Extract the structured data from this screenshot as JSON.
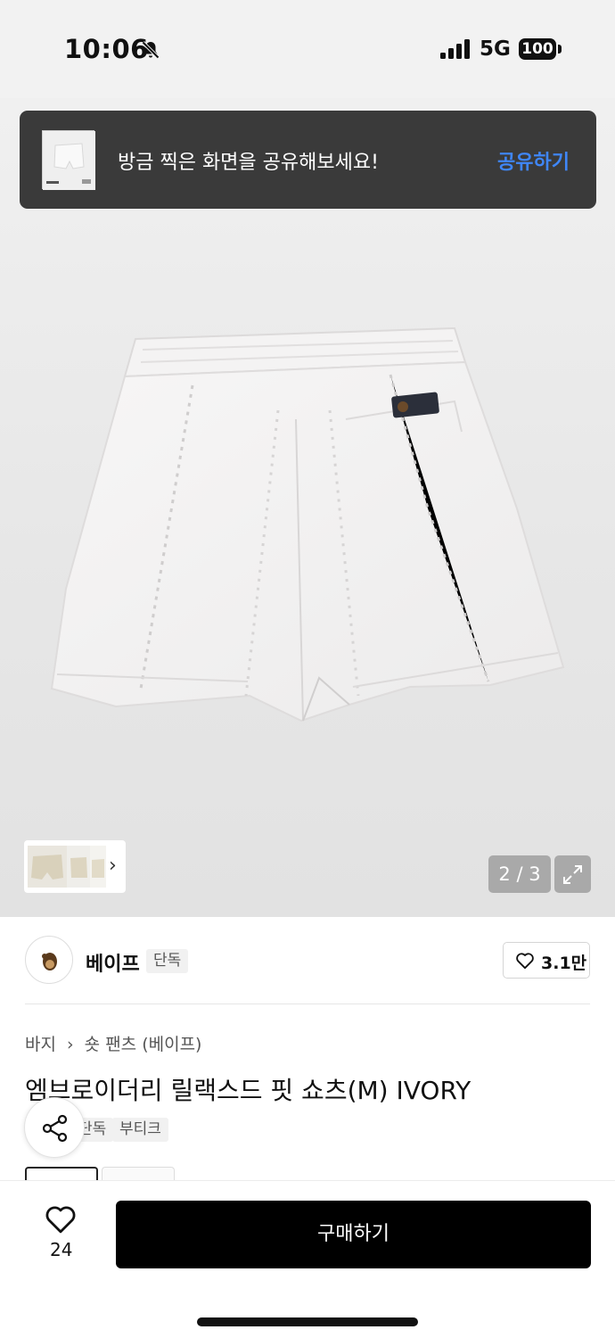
{
  "status_bar": {
    "time": "10:06",
    "network": "5G",
    "battery": "100",
    "icons": [
      "bell-muted-icon",
      "signal-icon",
      "battery-icon"
    ]
  },
  "toast": {
    "message": "방금 찍은 화면을 공유해보세요!",
    "action": "공유하기",
    "action_color": "#3f86f7"
  },
  "gallery": {
    "counter": "2 / 3",
    "chevron": "›"
  },
  "brand": {
    "name": "베이프",
    "badge": "단독",
    "like_count": "3.1만"
  },
  "product": {
    "breadcrumb": [
      "바지",
      "›",
      "숏 팬츠 (베이프)"
    ],
    "title": "엠브로이더리 릴랙스드 핏 쇼츠(M) IVORY",
    "tags": [
      "단독",
      "부티크"
    ]
  },
  "bottom_bar": {
    "wish_count": "24",
    "buy_label": "구매하기",
    "buy_color": "#000000"
  }
}
